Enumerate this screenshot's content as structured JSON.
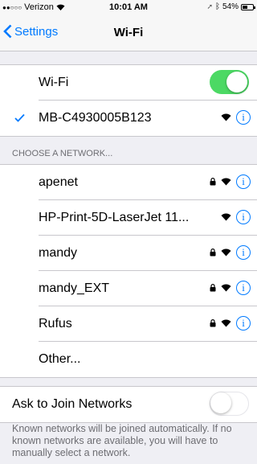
{
  "status": {
    "carrier": "Verizon",
    "time": "10:01 AM",
    "battery": "54%",
    "battery_level": 0.54
  },
  "nav": {
    "back_label": "Settings",
    "title": "Wi-Fi"
  },
  "wifi": {
    "label": "Wi-Fi",
    "enabled": true,
    "connected_network": "MB-C4930005B123"
  },
  "networks": {
    "header": "CHOOSE A NETWORK...",
    "items": [
      {
        "name": "apenet",
        "locked": true
      },
      {
        "name": "HP-Print-5D-LaserJet 11...",
        "locked": false
      },
      {
        "name": "mandy",
        "locked": true
      },
      {
        "name": "mandy_EXT",
        "locked": true
      },
      {
        "name": "Rufus",
        "locked": true
      }
    ],
    "other_label": "Other..."
  },
  "ask_join": {
    "label": "Ask to Join Networks",
    "enabled": false,
    "footer": "Known networks will be joined automatically. If no known networks are available, you will have to manually select a network."
  },
  "colors": {
    "accent": "#007aff",
    "toggle_on": "#4cd964"
  }
}
